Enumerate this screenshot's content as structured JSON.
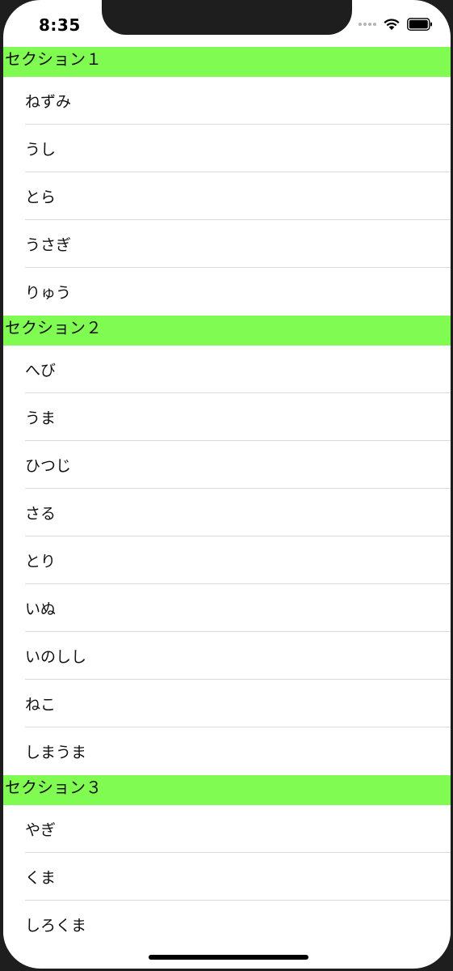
{
  "status_bar": {
    "time": "8:35"
  },
  "sections": [
    {
      "title": "セクション１",
      "items": [
        "ねずみ",
        "うし",
        "とら",
        "うさぎ",
        "りゅう"
      ]
    },
    {
      "title": "セクション２",
      "items": [
        "へび",
        "うま",
        "ひつじ",
        "さる",
        "とり",
        "いぬ",
        "いのしし",
        "ねこ",
        "しまうま"
      ]
    },
    {
      "title": "セクション３",
      "items": [
        "やぎ",
        "くま",
        "しろくま"
      ]
    }
  ],
  "colors": {
    "section_header_bg": "#80fb52",
    "separator": "#d9d9d9"
  },
  "icons": [
    "signal-dots-icon",
    "wifi-icon",
    "battery-icon"
  ]
}
